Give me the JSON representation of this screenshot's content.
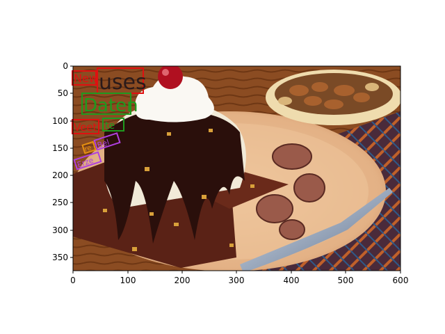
{
  "figure": {
    "x_ticks": [
      "0",
      "100",
      "200",
      "300",
      "400",
      "500",
      "600"
    ],
    "y_ticks": [
      "0",
      "50",
      "100",
      "150",
      "200",
      "250",
      "300",
      "350"
    ]
  },
  "image": {
    "caption": "Chocolate brownie sundae with whipped cream, cherry, chocolate curls, a fork, and a bowl of mixed nuts",
    "background_colors": {
      "wood": "#8a4a1f",
      "plate": "#e6b98e",
      "brownie": "#5a2216",
      "chocolate": "#2a0f0b",
      "cream": "#f3efe6",
      "cherry": "#b01020"
    }
  },
  "ocr_annotations": [
    {
      "text": "New",
      "color": "#e01010"
    },
    {
      "text": "uses",
      "color": "#e01010"
    },
    {
      "text": "Daten",
      "color": "#1f9a1f"
    },
    {
      "text": "Veet",
      "color": "#e01010"
    },
    {
      "text": "te",
      "color": "#1f9a1f"
    },
    {
      "text": "Bel",
      "color": "#b040e0"
    },
    {
      "text": "Erze",
      "color": "#b040e0"
    },
    {
      "text": "re",
      "color": "#e69010"
    }
  ]
}
